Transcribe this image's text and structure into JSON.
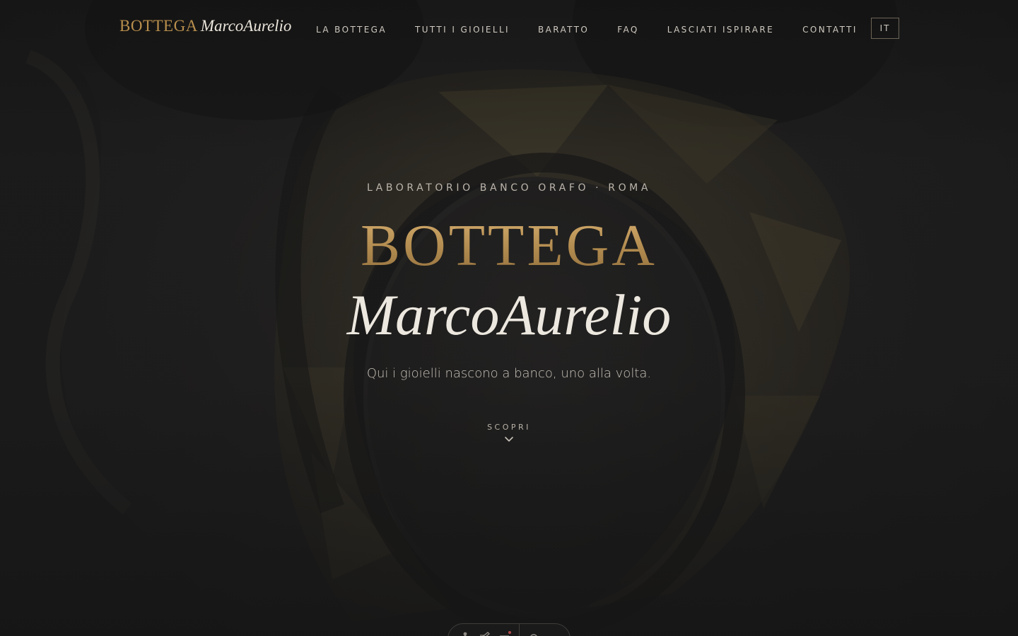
{
  "header": {
    "logo_main": "BOTTEGA",
    "logo_script": "MarcoAurelio",
    "nav": [
      {
        "label": "LA BOTTEGA"
      },
      {
        "label": "TUTTI I GIOIELLI"
      },
      {
        "label": "BARATTO"
      },
      {
        "label": "FAQ"
      },
      {
        "label": "LASCIATI ISPIRARE"
      },
      {
        "label": "CONTATTI"
      }
    ],
    "language": "IT"
  },
  "hero": {
    "eyebrow": "LABORATORIO BANCO ORAFO · ROMA",
    "title": "BOTTEGA",
    "title_script": "MarcoAurelio",
    "tagline": "Qui i gioielli nascono a banco, uno alla volta.",
    "cta_label": "SCOPRI",
    "cta_icon": "chevron-down-icon"
  },
  "toolbar": {
    "icons": [
      "accessibility-icon",
      "edit-icon",
      "menu-icon",
      "settings-icon"
    ]
  },
  "colors": {
    "background": "#1c1c1c",
    "gold": "#b98f4c",
    "text_light": "#ede8df",
    "text_muted": "#cfc9c0",
    "border": "#6c6456"
  }
}
